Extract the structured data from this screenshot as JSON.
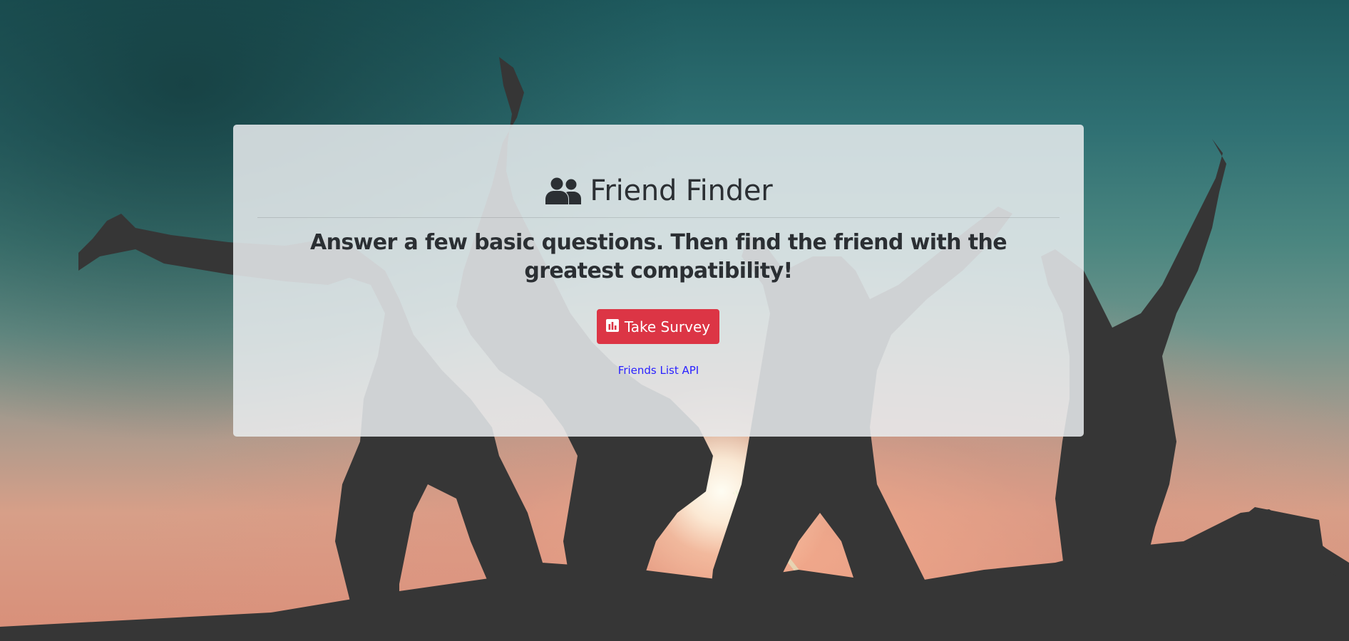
{
  "page": {
    "title": "Friend Finder",
    "title_icon": "users-icon"
  },
  "jumbotron": {
    "lead": "Answer a few basic questions. Then find the friend with the greatest compatibility!",
    "survey_button": {
      "label": "Take Survey",
      "icon": "bar-chart-icon",
      "color": "#dc3545"
    },
    "api_link": {
      "label": "Friends List API",
      "color": "#2b22ff"
    }
  },
  "background": {
    "image": "silhouettes of people jumping at sunset",
    "colors": [
      "#1e5a5e",
      "#6f958c",
      "#d79f88",
      "#3a3a3a"
    ]
  }
}
